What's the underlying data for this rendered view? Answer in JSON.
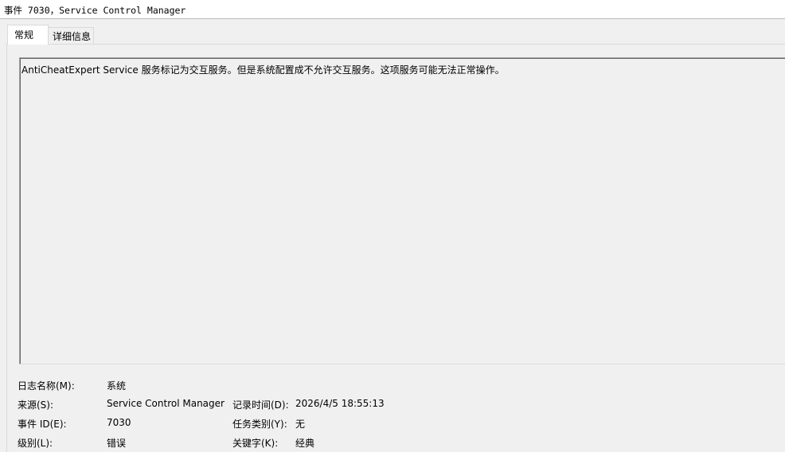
{
  "window": {
    "title": "事件 7030，Service Control Manager"
  },
  "tabs": [
    {
      "label": "常规"
    },
    {
      "label": "详细信息"
    }
  ],
  "description": "AntiCheatExpert Service 服务标记为交互服务。但是系统配置成不允许交互服务。这项服务可能无法正常操作。",
  "properties": {
    "log_name": {
      "label": "日志名称(M):",
      "value": "系统"
    },
    "source": {
      "label": "来源(S):",
      "value": "Service Control Manager"
    },
    "logged": {
      "label": "记录时间(D):",
      "value": "2026/4/5 18:55:13"
    },
    "event_id": {
      "label": "事件 ID(E):",
      "value": "7030"
    },
    "task_category": {
      "label": "任务类别(Y):",
      "value": "无"
    },
    "level": {
      "label": "级别(L):",
      "value": "错误"
    },
    "keywords": {
      "label": "关键字(K):",
      "value": "经典"
    }
  }
}
